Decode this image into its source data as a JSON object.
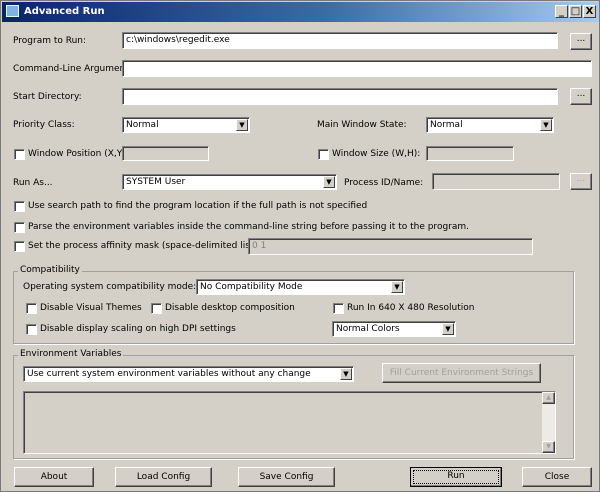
{
  "window": {
    "title": "Advanced Run",
    "minimize": "_",
    "maximize": "□",
    "close": "X"
  },
  "fields": {
    "program_label": "Program to Run:",
    "program_value": "c:\\windows\\regedit.exe",
    "browse": "...",
    "args_label": "Command-Line Arguments:",
    "args_value": "",
    "startdir_label": "Start Directory:",
    "startdir_value": "",
    "priority_label": "Priority Class:",
    "priority_value": "Normal",
    "winstate_label": "Main Window State:",
    "winstate_value": "Normal",
    "winpos_label": "Window Position (X,Y):",
    "winpos_checked": false,
    "winsize_label": "Window Size (W,H):",
    "winsize_checked": false,
    "runas_label": "Run As...",
    "runas_value": "SYSTEM User",
    "pid_label": "Process ID/Name:",
    "searchpath_label": "Use search path to find the program location if the full path is not specified",
    "parseenv_label": "Parse the environment variables inside the command-line string before passing it to the program.",
    "affinity_label": "Set the process affinity mask (space-delimited list):",
    "affinity_value": "0 1"
  },
  "compat": {
    "legend": "Compatibility",
    "os_label": "Operating system compatibility mode:",
    "os_value": "No Compatibility Mode",
    "themes": "Disable Visual Themes",
    "composition": "Disable desktop composition",
    "res640": "Run In 640 X 480 Resolution",
    "dpi": "Disable display scaling on high DPI settings",
    "colors_value": "Normal Colors"
  },
  "env": {
    "legend": "Environment Variables",
    "mode_value": "Use current system environment variables without any change",
    "fill_button": "Fill Current Environment Strings",
    "text": ""
  },
  "buttons": {
    "about": "About",
    "load": "Load Config",
    "save": "Save Config",
    "run": "Run",
    "close": "Close"
  }
}
